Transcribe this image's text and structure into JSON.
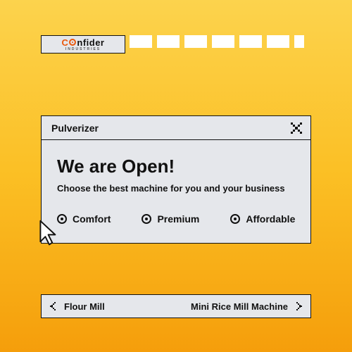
{
  "logo": {
    "prefix": "C",
    "suffix": "nfider",
    "sub": "INDUSTRIES"
  },
  "window": {
    "title": "Pulverizer",
    "heading": "We are Open!",
    "sub": "Choose the best machine for you and your business",
    "options": [
      "Comfort",
      "Premium",
      "Affordable"
    ]
  },
  "pager": {
    "prev": "Flour Mill",
    "next": "Mini Rice Mill Machine"
  }
}
